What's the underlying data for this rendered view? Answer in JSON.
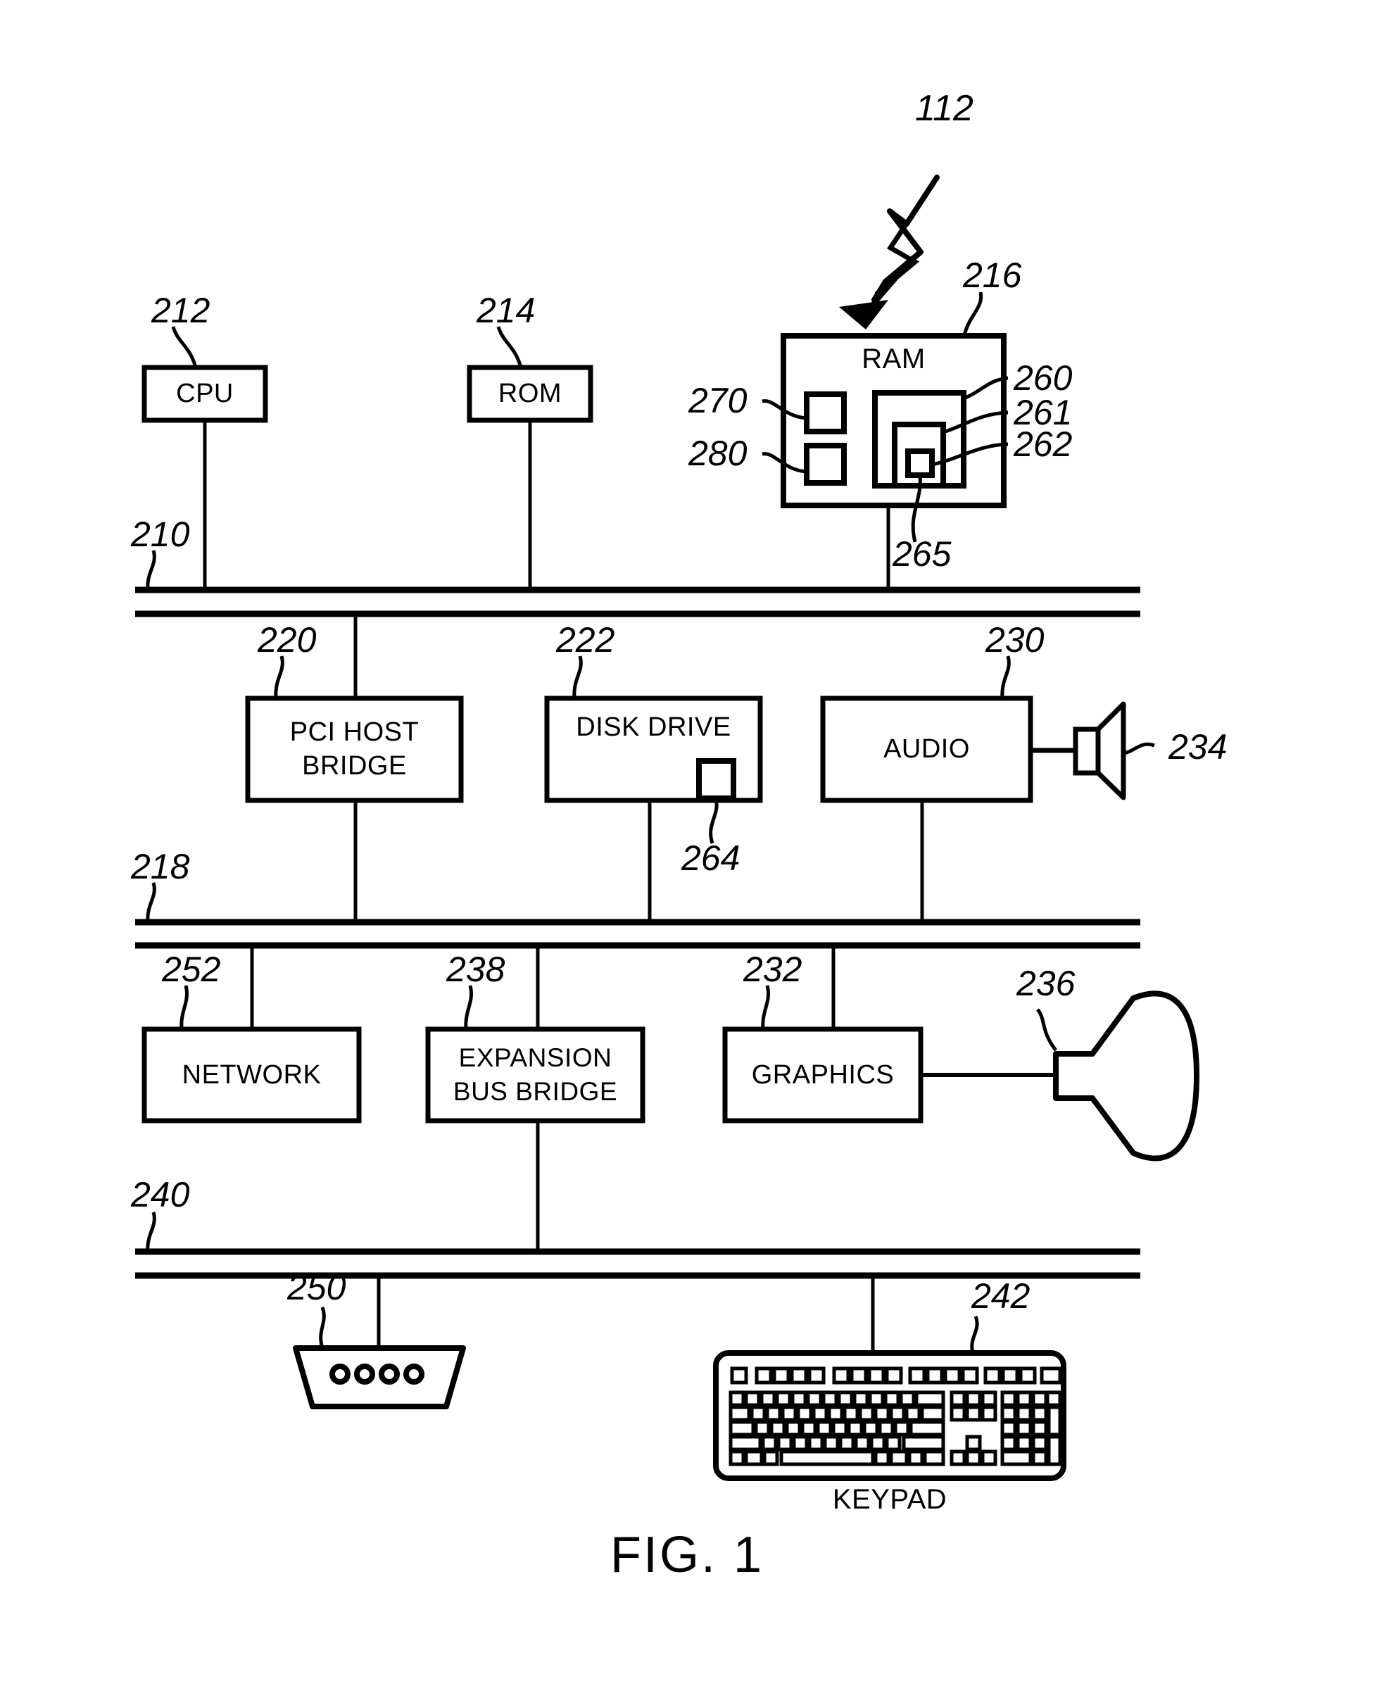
{
  "figure": {
    "caption": "FIG. 1",
    "system_ref": "112"
  },
  "blocks": [
    {
      "id": "cpu",
      "label": "CPU",
      "ref": "212"
    },
    {
      "id": "rom",
      "label": "ROM",
      "ref": "214"
    },
    {
      "id": "ram",
      "label": "RAM",
      "ref": "216"
    },
    {
      "id": "pci",
      "label": "PCI HOST BRIDGE",
      "line1": "PCI HOST",
      "line2": "BRIDGE",
      "ref": "220"
    },
    {
      "id": "disk",
      "label": "DISK DRIVE",
      "ref": "222"
    },
    {
      "id": "audio",
      "label": "AUDIO",
      "ref": "230"
    },
    {
      "id": "network",
      "label": "NETWORK",
      "ref": "252"
    },
    {
      "id": "expansion",
      "label": "EXPANSION BUS BRIDGE",
      "line1": "EXPANSION",
      "line2": "BUS BRIDGE",
      "ref": "238"
    },
    {
      "id": "graphics",
      "label": "GRAPHICS",
      "ref": "232"
    }
  ],
  "buses": [
    {
      "id": "system-bus",
      "ref": "210"
    },
    {
      "id": "pci-bus",
      "ref": "218"
    },
    {
      "id": "expansion-bus",
      "ref": "240"
    }
  ],
  "ram_internals": [
    {
      "id": "ram-box-270",
      "ref": "270"
    },
    {
      "id": "ram-box-280",
      "ref": "280"
    },
    {
      "id": "ram-box-260",
      "ref": "260"
    },
    {
      "id": "ram-box-261",
      "ref": "261"
    },
    {
      "id": "ram-box-262",
      "ref": "262"
    },
    {
      "id": "ram-box-265",
      "ref": "265"
    }
  ],
  "peripherals": [
    {
      "id": "speaker",
      "label": "",
      "ref": "234"
    },
    {
      "id": "display",
      "label": "",
      "ref": "236"
    },
    {
      "id": "mouse",
      "label": "",
      "ref": "250"
    },
    {
      "id": "keypad",
      "label": "KEYPAD",
      "ref": "242"
    }
  ],
  "misc": {
    "disk_media_ref": "264"
  },
  "colors": {
    "ink": "#000000",
    "paper": "#ffffff"
  }
}
